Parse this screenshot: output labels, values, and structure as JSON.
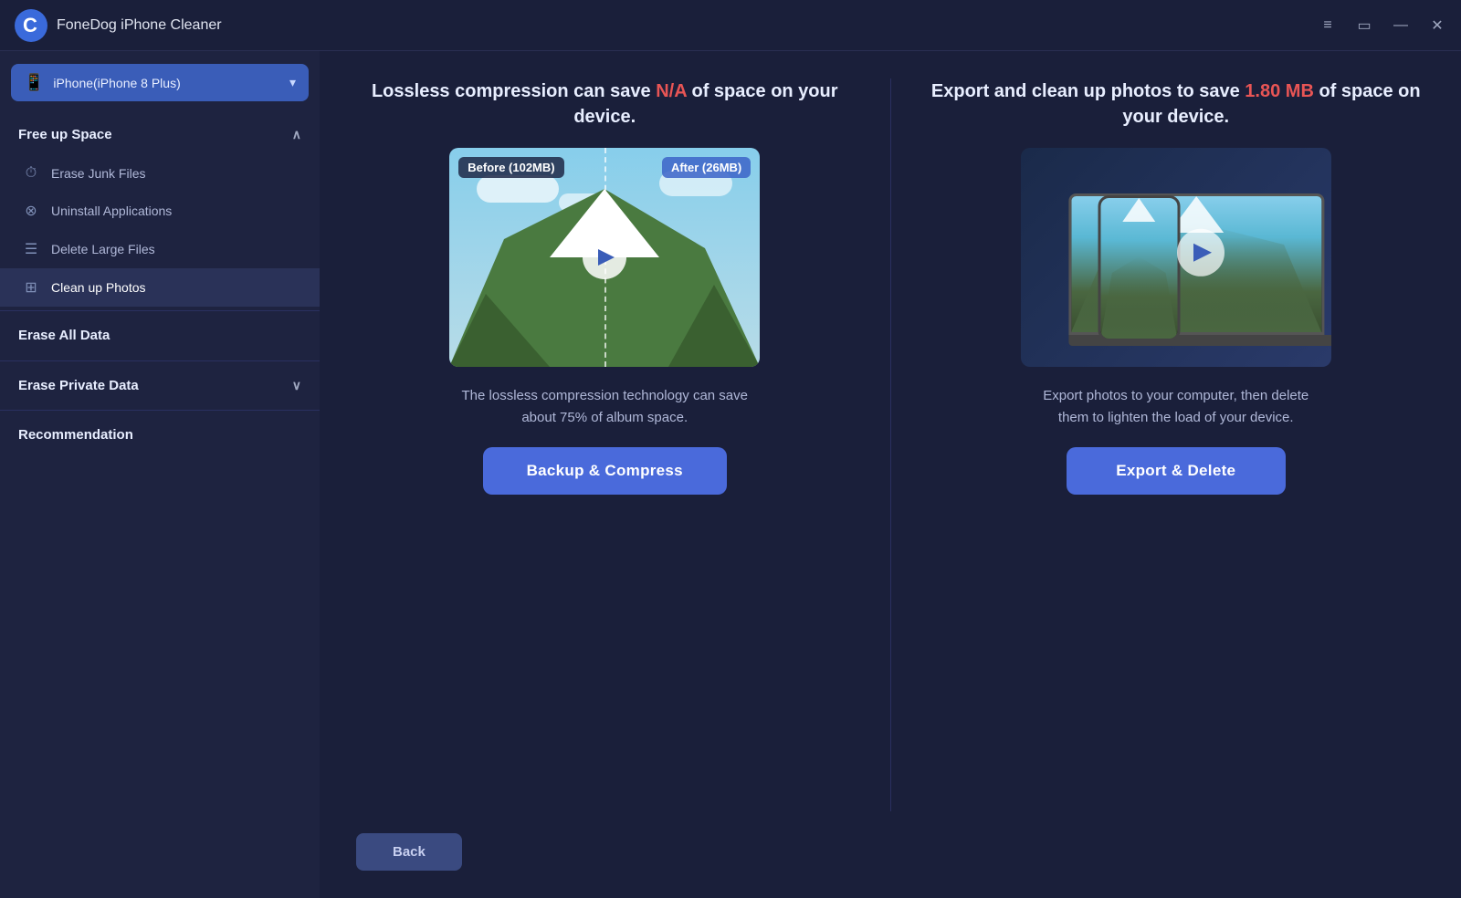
{
  "app": {
    "title": "FoneDog iPhone Cleaner",
    "logo_char": "C"
  },
  "titlebar": {
    "menu_icon": "≡",
    "chat_icon": "▭",
    "minimize_icon": "—",
    "close_icon": "✕"
  },
  "device_selector": {
    "label": "iPhone(iPhone 8 Plus)",
    "arrow": "▾"
  },
  "sidebar": {
    "free_up_space": {
      "label": "Free up Space",
      "collapsed": false,
      "items": [
        {
          "id": "erase-junk",
          "label": "Erase Junk Files",
          "icon": "⏱"
        },
        {
          "id": "uninstall-apps",
          "label": "Uninstall Applications",
          "icon": "⊗"
        },
        {
          "id": "delete-large",
          "label": "Delete Large Files",
          "icon": "☰"
        },
        {
          "id": "clean-photos",
          "label": "Clean up Photos",
          "icon": "⊞",
          "active": true
        }
      ]
    },
    "erase_all": {
      "label": "Erase All Data"
    },
    "erase_private": {
      "label": "Erase Private Data",
      "has_arrow": true
    },
    "recommendation": {
      "label": "Recommendation"
    }
  },
  "left_card": {
    "title_start": "Lossless compression can save ",
    "title_highlight": "N/A",
    "title_end": " of space on your device.",
    "label_before": "Before (102MB)",
    "label_after": "After (26MB)",
    "description": "The lossless compression technology can save about 75% of album space.",
    "button_label": "Backup & Compress"
  },
  "right_card": {
    "title_start": "Export and clean up photos to save ",
    "title_highlight": "1.80 MB",
    "title_end": " of space on your device.",
    "description": "Export photos to your computer, then delete them to lighten the load of your device.",
    "button_label": "Export & Delete"
  },
  "bottom": {
    "back_label": "Back"
  }
}
